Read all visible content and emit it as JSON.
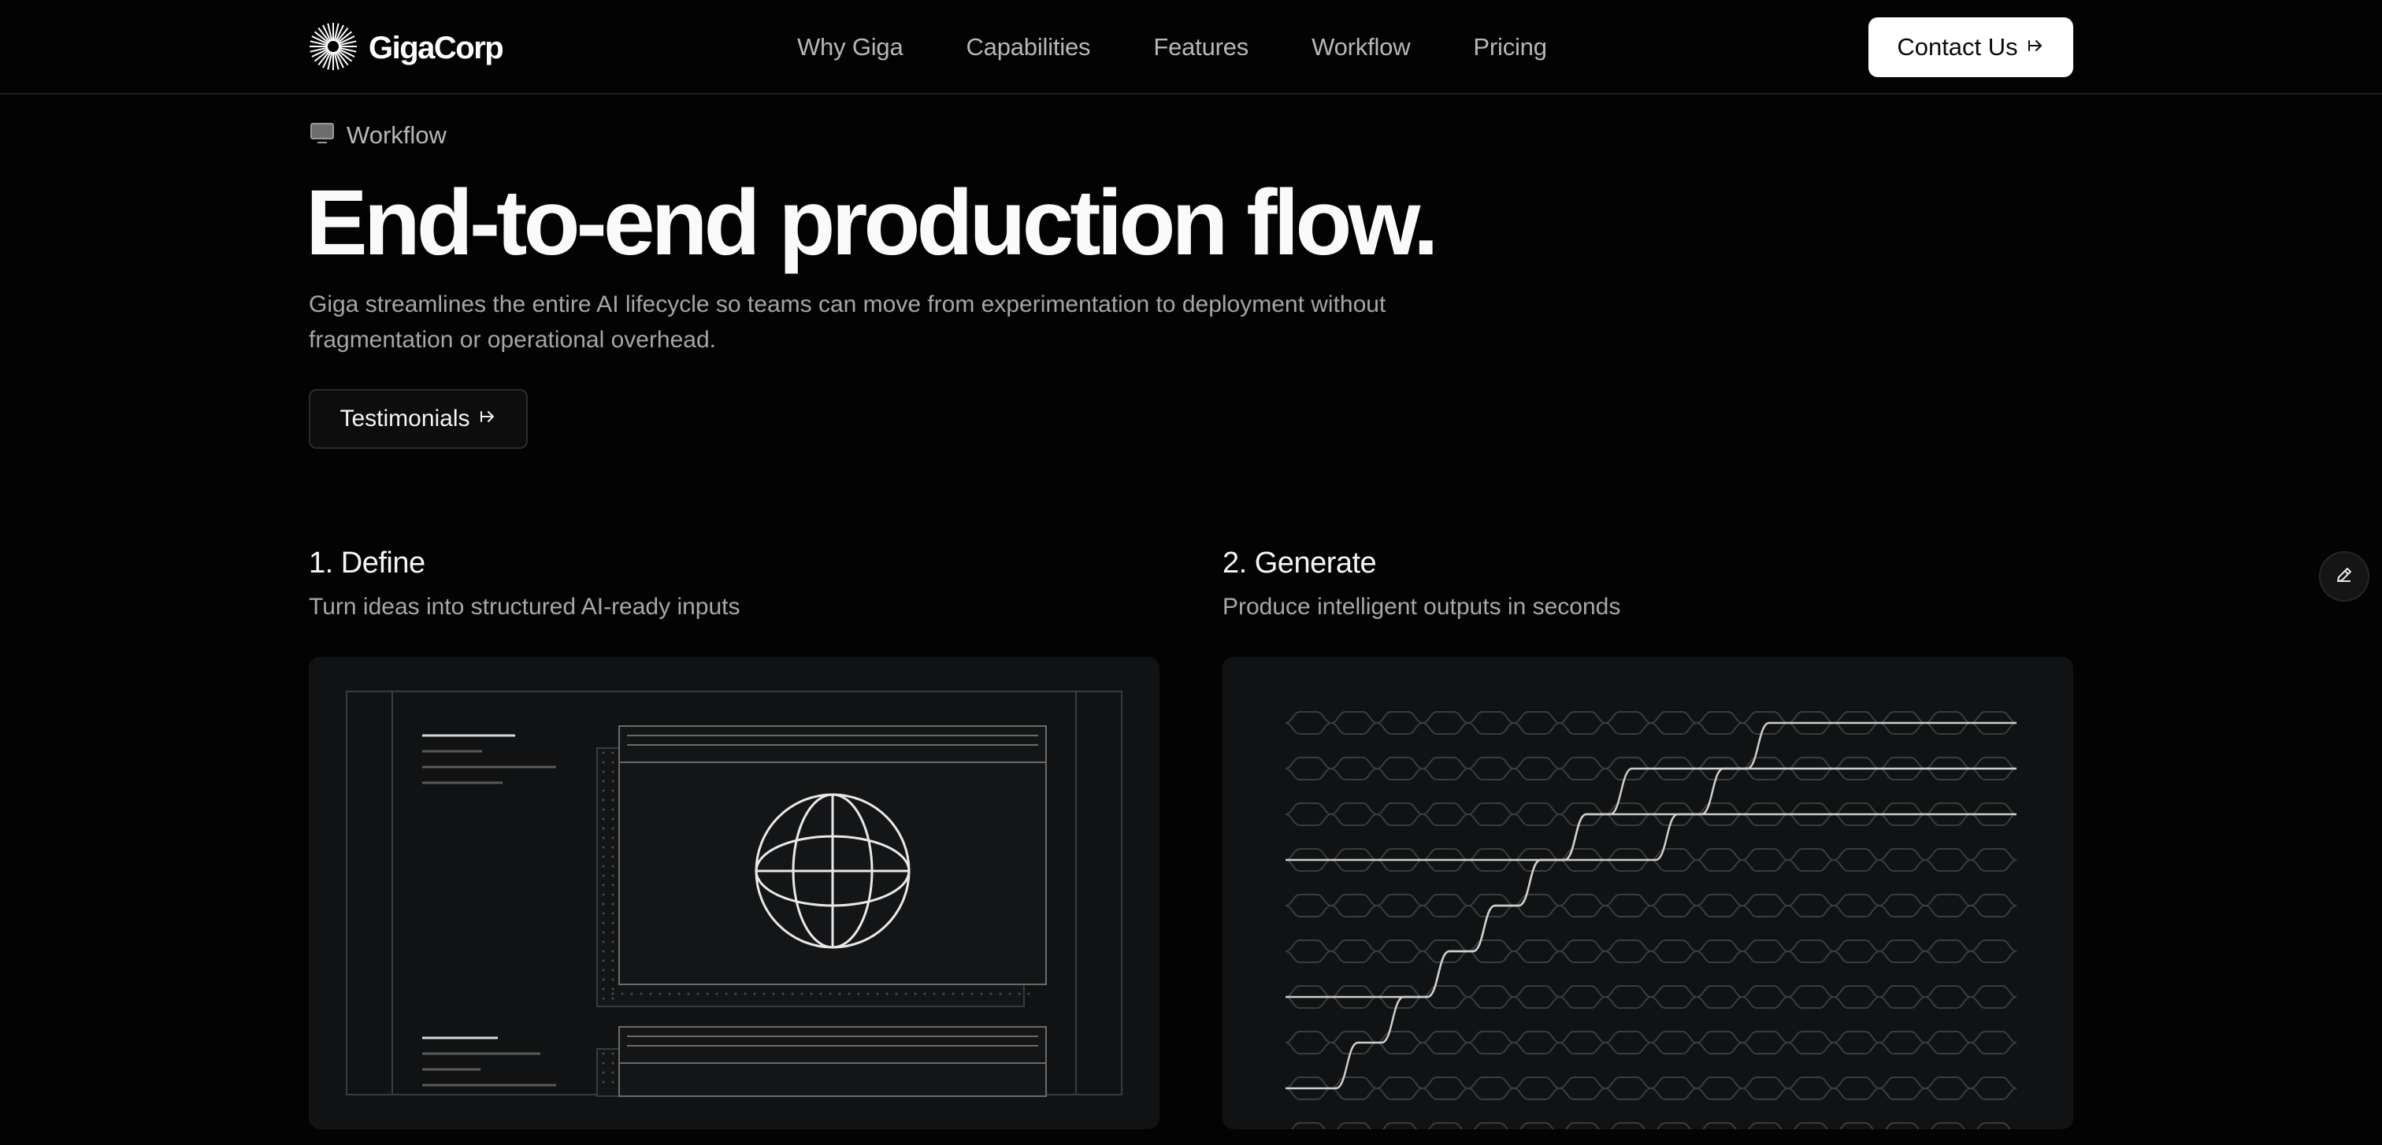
{
  "header": {
    "logo_text": "GigaCorp",
    "logo_icon": "starburst-logo-icon",
    "nav": [
      {
        "label": "Why Giga"
      },
      {
        "label": "Capabilities"
      },
      {
        "label": "Features"
      },
      {
        "label": "Workflow"
      },
      {
        "label": "Pricing"
      }
    ],
    "contact_label": "Contact Us",
    "contact_icon": "arrow-right-icon"
  },
  "hero": {
    "tag_icon": "monitor-icon",
    "tag_label": "Workflow",
    "title": "End-to-end production flow.",
    "description": "Giga streamlines the entire AI lifecycle so teams can move from experimentation to deployment without fragmentation or operational overhead.",
    "cta_label": "Testimonials"
  },
  "steps": [
    {
      "title": "1. Define",
      "subtitle": "Turn ideas into structured AI-ready inputs",
      "illustration": "wireframe-globe-illustration"
    },
    {
      "title": "2. Generate",
      "subtitle": "Produce intelligent outputs in seconds",
      "illustration": "hexagon-network-illustration"
    }
  ],
  "floating": {
    "edit_icon": "pencil-icon"
  },
  "colors": {
    "background": "#030303",
    "card": "#111213",
    "primary_button": "#ffffff",
    "muted_text": "#a6a6a6"
  }
}
